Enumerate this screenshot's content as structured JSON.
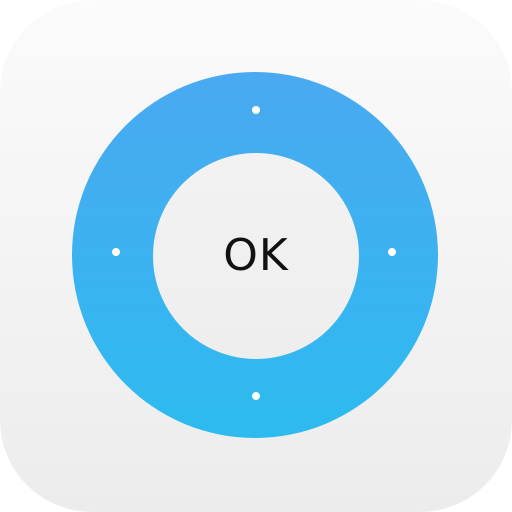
{
  "icon": {
    "name": "remote-control-app-icon",
    "colors": {
      "background_top": "#fbfbfb",
      "background_bottom": "#ececec",
      "ring_top": "#4aa9f1",
      "ring_bottom": "#2dbbef",
      "center": "#f0f0f0",
      "dot": "#ffffff",
      "text": "#111111"
    }
  },
  "remote": {
    "ok_label": "OK",
    "directions": [
      "up",
      "down",
      "left",
      "right"
    ]
  }
}
